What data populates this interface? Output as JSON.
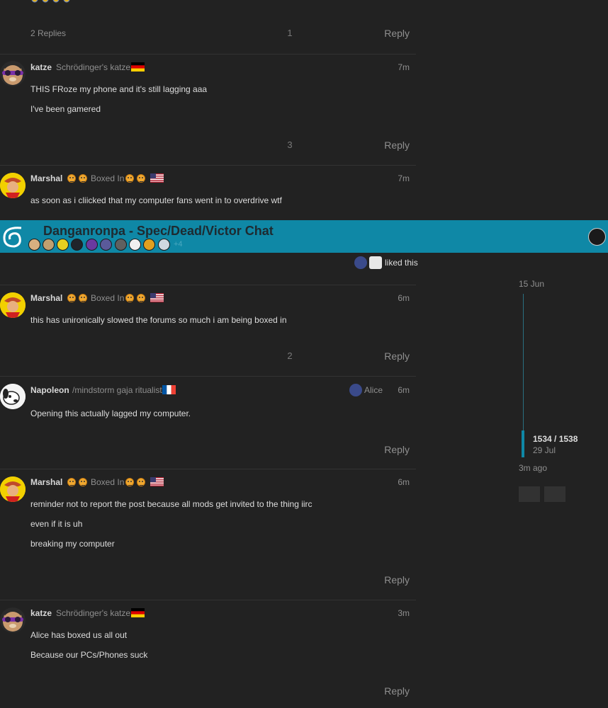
{
  "post0": {
    "replies": "2 Replies",
    "likes": "1",
    "reply": "Reply"
  },
  "post1": {
    "username": "katze",
    "user_title": "Schrödinger's katze",
    "time": "7m",
    "lines": [
      "THIS FRoze my phone and it's still lagging aaa",
      "I've been gamered"
    ],
    "likes": "3",
    "reply": "Reply"
  },
  "post2": {
    "username": "Marshal",
    "user_title": "Boxed In",
    "time": "7m",
    "lines": [
      "as soon as i cliicked that my computer fans went in to overdrive wtf"
    ]
  },
  "chat": {
    "title": "Danganronpa - Spec/Dead/Victor Chat",
    "extra": "+4"
  },
  "liked": {
    "text": "liked this"
  },
  "post3": {
    "username": "Marshal",
    "user_title": "Boxed In",
    "time": "6m",
    "lines": [
      "this has unironically slowed the forums so much i am being boxed in"
    ],
    "likes": "2",
    "reply": "Reply"
  },
  "post4": {
    "username": "Napoleon",
    "user_title": "/mindstorm gaja ritualist",
    "reply_to": "Alice",
    "time": "6m",
    "lines": [
      "Opening this actually lagged my computer."
    ],
    "reply": "Reply"
  },
  "post5": {
    "username": "Marshal",
    "user_title": "Boxed In",
    "time": "6m",
    "lines": [
      "reminder not to report the post because all mods get invited to the thing iirc",
      "even if it is uh",
      "breaking my computer"
    ],
    "reply": "Reply"
  },
  "post6": {
    "username": "katze",
    "user_title": "Schrödinger's katze",
    "time": "3m",
    "lines": [
      "Alice has boxed us all out",
      "Because our PCs/Phones suck"
    ],
    "reply": "Reply"
  },
  "timeline": {
    "start": "15 Jun",
    "position": "1534 / 1538",
    "date": "29 Jul",
    "ago": "3m ago"
  },
  "colors": {
    "background": "#222222",
    "chat_banner": "#0f88a6",
    "text": "#dddddd",
    "muted": "#8f8f8f"
  }
}
